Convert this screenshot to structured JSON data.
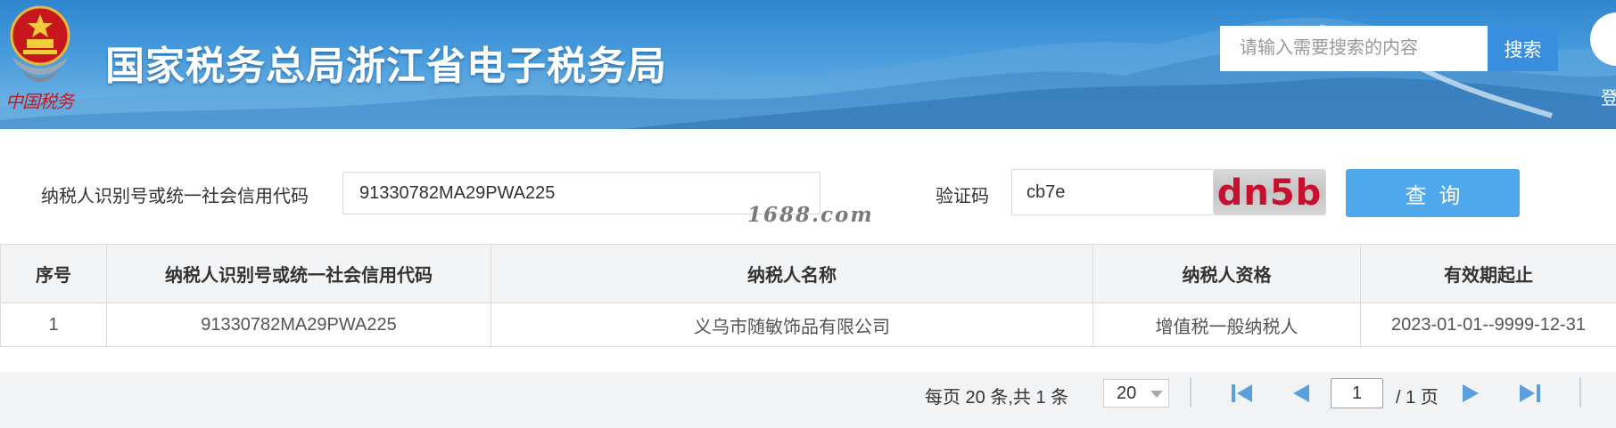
{
  "header": {
    "emblem_caption": "中国税务",
    "site_title": "国家税务总局浙江省电子税务局",
    "search_placeholder": "请输入需要搜索的内容",
    "search_button": "搜索",
    "login_label": "登"
  },
  "form": {
    "taxid_label": "纳税人识别号或统一社会信用代码",
    "taxid_value": "91330782MA29PWA225",
    "captcha_label": "验证码",
    "captcha_value": "cb7e",
    "captcha_image_text": "dn5b",
    "query_button": "查询"
  },
  "watermark": "1688.com",
  "table": {
    "headers": [
      "序号",
      "纳税人识别号或统一社会信用代码",
      "纳税人名称",
      "纳税人资格",
      "有效期起止"
    ],
    "rows": [
      [
        "1",
        "91330782MA29PWA225",
        "义乌市随敏饰品有限公司",
        "增值税一般纳税人",
        "2023-01-01--9999-12-31"
      ]
    ]
  },
  "pagination": {
    "summary": "每页 20 条,共 1 条",
    "page_size": "20",
    "current_page": "1",
    "total_pages": "/ 1 页"
  },
  "colors": {
    "banner": "#3a8fd6",
    "button_blue": "#4fa7ec",
    "search_button": "#3a8ee0",
    "captcha_text": "#c8102e",
    "nav_arrow": "#5a9fe0"
  }
}
